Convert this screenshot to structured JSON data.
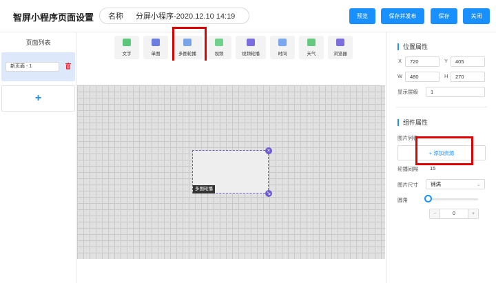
{
  "header": {
    "title": "智屏小程序页面设置",
    "name_label": "名称",
    "name_value": "分屏小程序-2020.12.10 14:19",
    "buttons": {
      "preview": "预览",
      "save_publish": "保存并发布",
      "save": "保存",
      "close": "关闭"
    },
    "accent_color": "#1890ff"
  },
  "left_panel": {
    "title": "页面列表",
    "pages": [
      {
        "name": "新页面 - 1"
      }
    ],
    "add_symbol": "+"
  },
  "toolbar": {
    "tools": [
      {
        "label": "文字",
        "icon": "text-icon",
        "color": "#5cc77a",
        "glyph": "T"
      },
      {
        "label": "单图",
        "icon": "image-icon",
        "color": "#6c7ee1",
        "glyph": "▣"
      },
      {
        "label": "多图轮播",
        "icon": "carousel-icon",
        "color": "#78a6e8",
        "glyph": "▤"
      },
      {
        "label": "视频",
        "icon": "video-icon",
        "color": "#6fd18c",
        "glyph": "▶"
      },
      {
        "label": "视频轮播",
        "icon": "video-carousel-icon",
        "color": "#7b6fe0",
        "glyph": "◉"
      },
      {
        "label": "时间",
        "icon": "clock-icon",
        "color": "#7aa8ef",
        "glyph": "◷"
      },
      {
        "label": "天气",
        "icon": "weather-icon",
        "color": "#67c97e",
        "glyph": "☁"
      },
      {
        "label": "浏览器",
        "icon": "browser-icon",
        "color": "#7b6fe0",
        "glyph": "⊘"
      }
    ]
  },
  "canvas": {
    "component_label": "多图轮播"
  },
  "right_panel": {
    "position_title": "位置属性",
    "x_label": "X",
    "x_value": "720",
    "y_label": "Y",
    "y_value": "405",
    "w_label": "W",
    "w_value": "480",
    "h_label": "H",
    "h_value": "270",
    "layer_label": "显示层级",
    "layer_value": "1",
    "component_title": "组件属性",
    "image_list_label": "图片列表",
    "add_resource": "+ 添加资源",
    "interval_label": "轮播间隔",
    "interval_value": "15",
    "size_label": "图片尺寸",
    "size_value": "铺满",
    "radius_label": "圆角",
    "stepper_minus": "−",
    "stepper_value": "0",
    "stepper_plus": "+"
  }
}
